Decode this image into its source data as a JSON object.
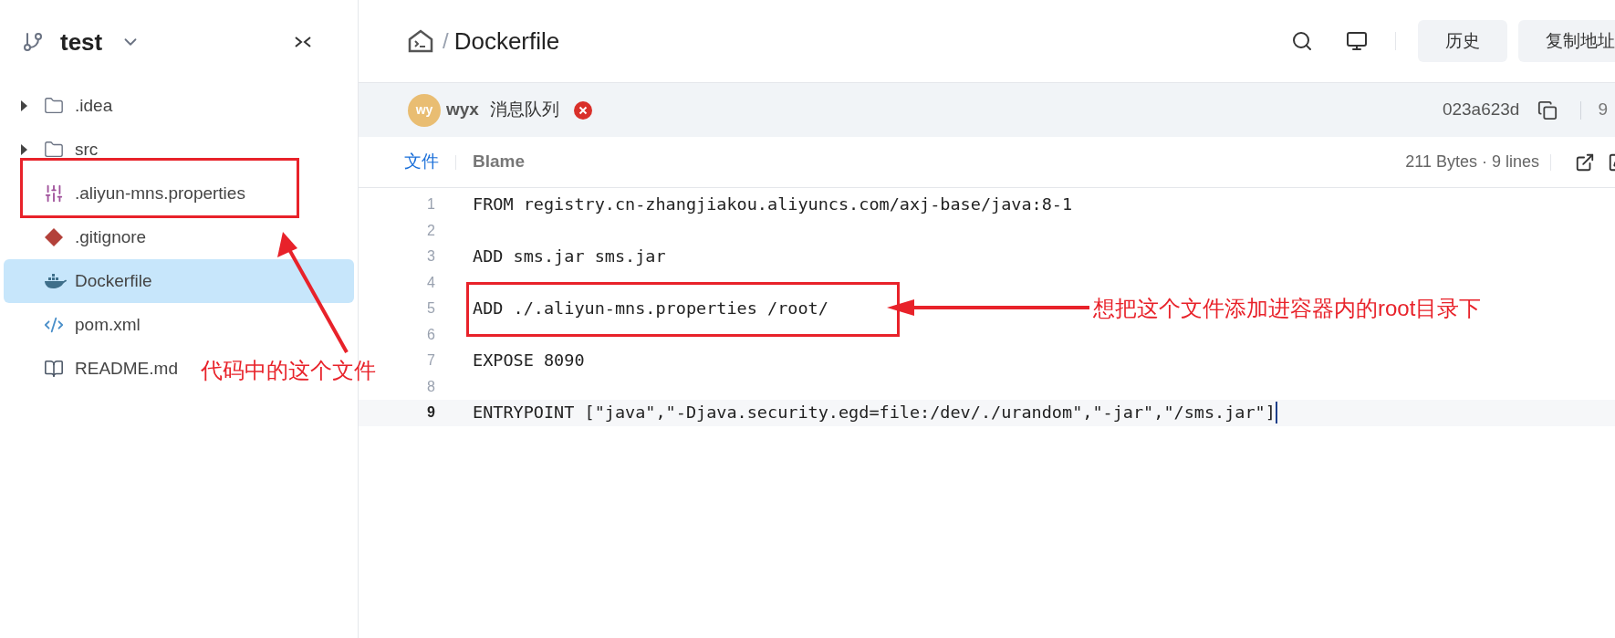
{
  "sidebar": {
    "branch": "test",
    "items": [
      {
        "kind": "folder",
        "name": ".idea",
        "selected": false
      },
      {
        "kind": "folder",
        "name": "src",
        "selected": false
      },
      {
        "kind": "properties",
        "name": ".aliyun-mns.properties",
        "selected": false
      },
      {
        "kind": "git",
        "name": ".gitignore",
        "selected": false
      },
      {
        "kind": "docker",
        "name": "Dockerfile",
        "selected": true
      },
      {
        "kind": "xml",
        "name": "pom.xml",
        "selected": false
      },
      {
        "kind": "readme",
        "name": "README.md",
        "selected": false
      }
    ]
  },
  "header": {
    "separator": "/",
    "title": "Dockerfile",
    "buttons": [
      "历史",
      "复制地址"
    ]
  },
  "commit": {
    "avatar": "wy",
    "author": "wyx",
    "message": "消息队列",
    "hash": "023a623d",
    "time": "9"
  },
  "tabs": [
    {
      "label": "文件",
      "selected": true
    },
    {
      "label": "Blame",
      "selected": false
    }
  ],
  "file_info": "211 Bytes · 9 lines",
  "code": [
    {
      "number": "1",
      "text": "FROM registry.cn-zhangjiakou.aliyuncs.com/axj-base/java:8-1",
      "current": false
    },
    {
      "number": "2",
      "current": false
    },
    {
      "number": "3",
      "text": "ADD sms.jar sms.jar",
      "current": false
    },
    {
      "number": "4",
      "current": false
    },
    {
      "number": "5",
      "text": "ADD ./.aliyun-mns.properties /root/",
      "current": false
    },
    {
      "number": "6",
      "current": false
    },
    {
      "number": "7",
      "text": "EXPOSE 8090",
      "current": false
    },
    {
      "number": "8",
      "current": false
    },
    {
      "number": "9",
      "text": "ENTRYPOINT [\"java\",\"-Djava.security.egd=file:/dev/./urandom\",\"-jar\",\"/sms.jar\"]",
      "current": true
    }
  ],
  "annotations": [
    {
      "kind": "sidebar",
      "text": "代码中的这个文件"
    },
    {
      "kind": "code",
      "text": "想把这个文件添加进容器内的root目录下"
    }
  ]
}
